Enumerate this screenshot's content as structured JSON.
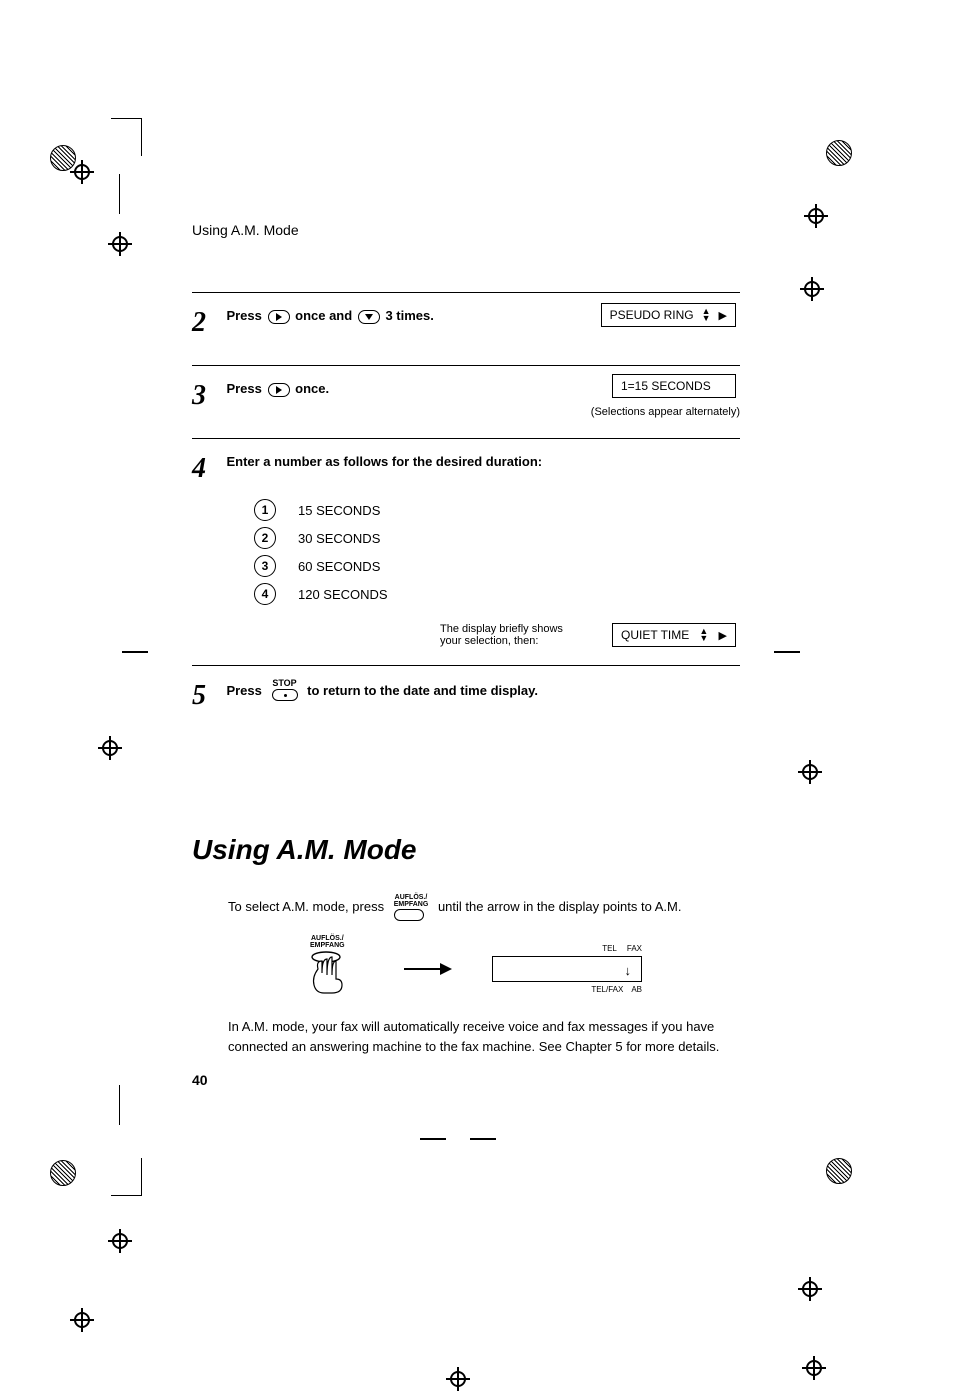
{
  "running_head": "Using A.M. Mode",
  "steps": {
    "s2": {
      "num": "2",
      "pre": "Press ",
      "mid": " once and ",
      "post": " 3 times.",
      "lcd": "PSEUDO RING"
    },
    "s3": {
      "num": "3",
      "pre": "Press ",
      "post": " once.",
      "lcd": "1=15 SECONDS",
      "note": "(Selections appear alternately)"
    },
    "s4": {
      "num": "4",
      "text": "Enter a number as follows for the desired duration:",
      "options": [
        {
          "key": "1",
          "label": "15 SECONDS"
        },
        {
          "key": "2",
          "label": "30 SECONDS"
        },
        {
          "key": "3",
          "label": "60 SECONDS"
        },
        {
          "key": "4",
          "label": "120 SECONDS"
        }
      ],
      "brief": "The display briefly shows your selection, then:",
      "lcd": "QUIET TIME"
    },
    "s5": {
      "num": "5",
      "pre": "Press ",
      "stop": "STOP",
      "post": " to return to the date and time display."
    }
  },
  "section": {
    "title": "Using A.M. Mode",
    "p1a": "To select A.M. mode, press ",
    "key_label": "AUFLÖS./\nEMPFANG",
    "p1b": " until the arrow in the display points to A.M.",
    "disp_top": [
      "TEL",
      "FAX"
    ],
    "disp_bot": [
      "TEL/FAX",
      "AB"
    ],
    "disp_arrow": "↓",
    "p2": "In A.M. mode, your fax will automatically receive voice and fax messages if you have connected an answering machine to the fax machine. See Chapter 5 for more details."
  },
  "page_number": "40"
}
